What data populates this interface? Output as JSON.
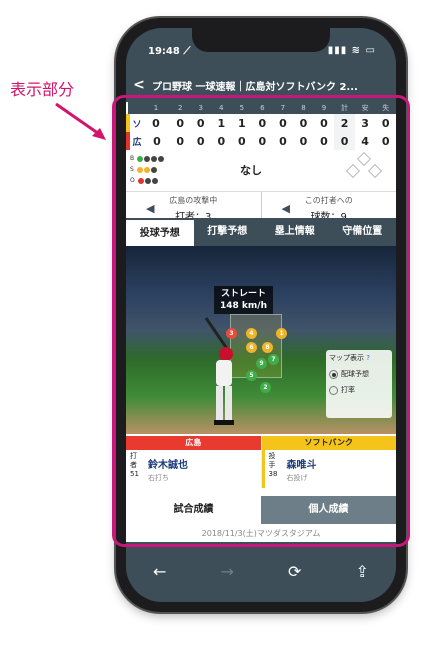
{
  "callout": {
    "label": "表示部分"
  },
  "status": {
    "time": "19:48 ⟋",
    "icons": "▮▮▮ ≋ ▭"
  },
  "titlebar": {
    "back": "<",
    "title": "プロ野球 一球速報｜広島対ソフトバンク 2..."
  },
  "scoreboard": {
    "innings": [
      "1",
      "2",
      "3",
      "4",
      "5",
      "6",
      "7",
      "8",
      "9",
      "計",
      "安",
      "失"
    ],
    "teams": [
      {
        "abbr": "ソ",
        "color": "#f5c41a",
        "scores": [
          "0",
          "0",
          "0",
          "1",
          "1",
          "0",
          "0",
          "0",
          "0"
        ],
        "total": "2",
        "hits": "3",
        "errors": "0"
      },
      {
        "abbr": "広",
        "color": "#e0342c",
        "scores": [
          "0",
          "0",
          "0",
          "0",
          "0",
          "0",
          "0",
          "0",
          "0"
        ],
        "total": "0",
        "hits": "4",
        "errors": "0"
      }
    ]
  },
  "count": {
    "b": "B",
    "s": "S",
    "o": "O",
    "runner": "なし"
  },
  "attack": {
    "left_title": "広島の攻撃中",
    "left_value": "打者：3",
    "right_title": "この打者への",
    "right_value": "球数：9"
  },
  "tabs": [
    "投球予想",
    "打撃予想",
    "塁上情報",
    "守備位置"
  ],
  "pitch": {
    "type": "ストレート",
    "speed": "148 km/h"
  },
  "balls": [
    {
      "n": "3",
      "color": "#e84a3c"
    },
    {
      "n": "4",
      "color": "#f0b429"
    },
    {
      "n": "1",
      "color": "#f0b429"
    },
    {
      "n": "6",
      "color": "#f0b429"
    },
    {
      "n": "8",
      "color": "#f0b429"
    },
    {
      "n": "7",
      "color": "#3fae49"
    },
    {
      "n": "9",
      "color": "#3fae49"
    },
    {
      "n": "5",
      "color": "#3fae49"
    },
    {
      "n": "2",
      "color": "#3fae49"
    }
  ],
  "map_panel": {
    "title": "マップ表示",
    "help": "?",
    "opt1": "配球予想",
    "opt2": "打率"
  },
  "players": {
    "home": {
      "team": "広島",
      "role": "打者",
      "number": "51",
      "name": "鈴木誠也",
      "sub": "右打ち",
      "color": "#e83a2f"
    },
    "away": {
      "team": "ソフトバンク",
      "role": "投手",
      "number": "38",
      "name": "森唯斗",
      "sub": "右投げ",
      "color": "#f5c41a"
    }
  },
  "lowtabs": [
    "試合成績",
    "個人成績"
  ],
  "date": "2018/11/3(土)マツダスタジアム",
  "bottombar": {
    "back": "←",
    "forward": "→",
    "reload": "⟳",
    "share": "⇪"
  }
}
